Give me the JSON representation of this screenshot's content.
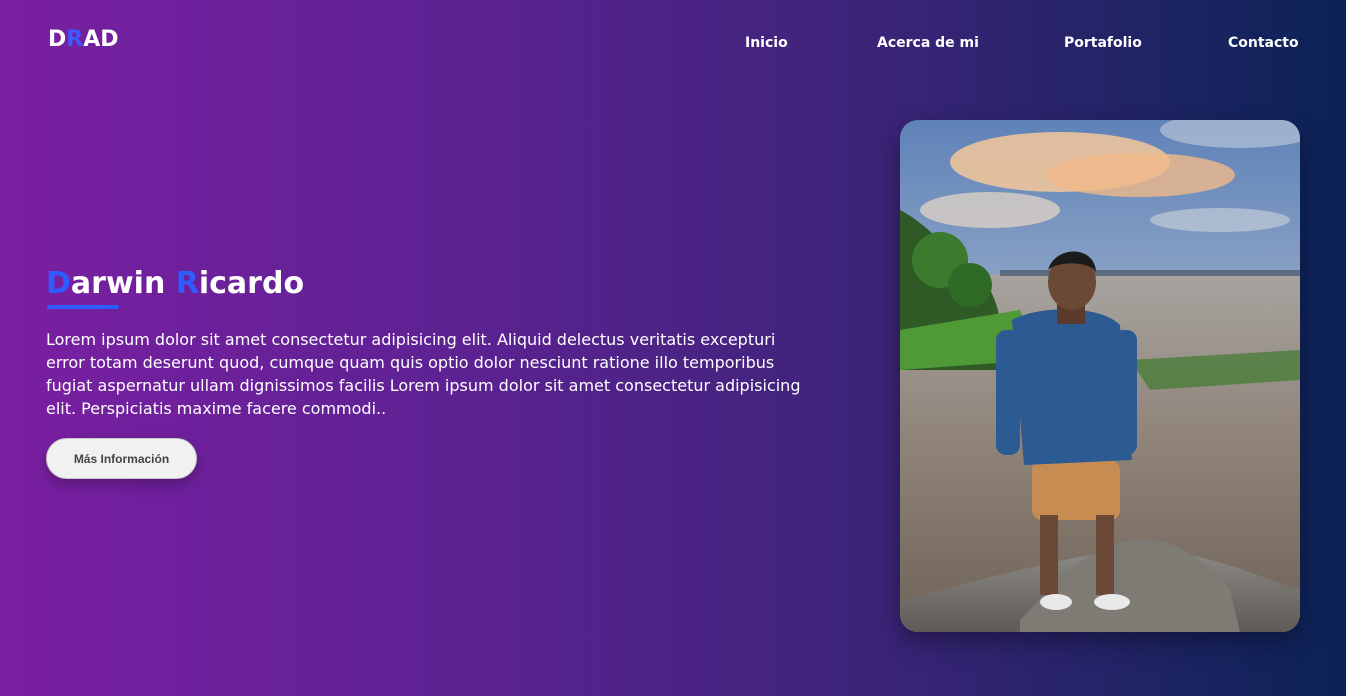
{
  "brand": {
    "logo_parts": [
      "D",
      "R",
      "AD"
    ]
  },
  "nav": {
    "items": [
      "Inicio",
      "Acerca de mi",
      "Portafolio",
      "Contacto"
    ]
  },
  "hero": {
    "title_first_initial": "D",
    "title_first_rest": "arwin ",
    "title_last_initial": "R",
    "title_last_rest": "icardo",
    "description": "Lorem ipsum dolor sit amet consectetur adipisicing elit. Aliquid delectus veritatis excepturi error totam deserunt quod, cumque quam quis optio dolor nesciunt ratione illo temporibus fugiat aspernatur ullam dignissimos facilis Lorem ipsum dolor sit amet consectetur adipisicing elit. Perspiciatis maxime facere commodi..",
    "button_label": "Más Información"
  },
  "colors": {
    "gradient_start": "#7a1fa2",
    "gradient_end": "#0b2356",
    "accent": "#2f5cff",
    "button_bg": "#f1f1f1"
  },
  "icons": {
    "portrait": "portrait-photo"
  }
}
